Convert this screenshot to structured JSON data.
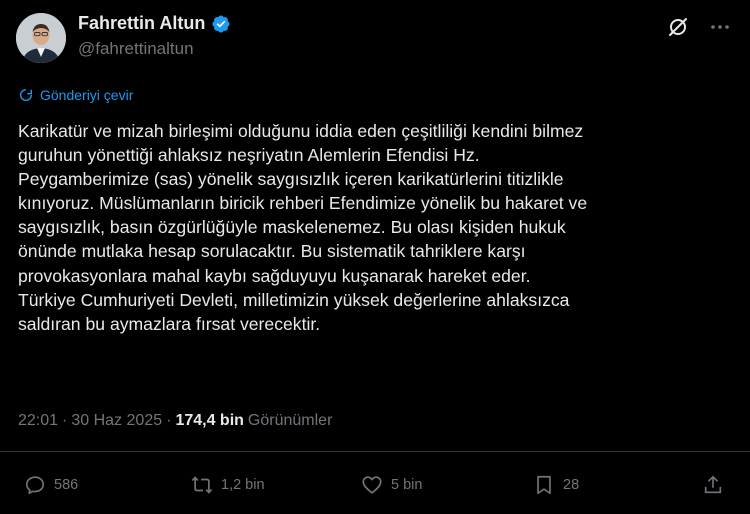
{
  "tweet": {
    "author": {
      "display_name": "Fahrettin Altun",
      "handle": "@fahrettinaltun",
      "verified_icon": "verified-badge-icon"
    },
    "translate_label": "Gönderiyi çevir",
    "text": "Karikatür ve mizah birleşimi olduğunu iddia eden çeşitliliği kendini bilmez\nguruhun yönettiği ahlaksız neşriyatın Alemlerin Efendisi Hz.\nPeygamberimize (sas) yönelik saygısızlık içeren karikatürlerini titizlikle\nkınıyoruz. Müslümanların biricik rehberi Efendimize yönelik bu hakaret ve\nsaygısızlık, basın özgürlüğüyle maskelenemez. Bu olası kişiden hukuk\nönünde mutlaka hesap sorulacaktır. Bu sistematik tahriklere karşı\nprovokasyonlara mahal kaybı sağduyuyu kuşanarak hareket eder.\nTürkiye Cumhuriyeti Devleti, milletimizin yüksek değerlerine ahlaksızca\nsaldıran bu aymazlara fırsat verecektir.",
    "time": "22:01",
    "dot1": "·",
    "date": "30 Haz 2025",
    "dot2": "·",
    "views_count": "174,4 bin",
    "views_label": "Görünümler",
    "actions": {
      "replies": "586",
      "reposts": "1,2 bin",
      "likes": "5 bin",
      "bookmarks": "28"
    }
  },
  "colors": {
    "background": "#000000",
    "text": "#e7e9ea",
    "secondary": "#71767b",
    "accent": "#1d9bf0"
  }
}
